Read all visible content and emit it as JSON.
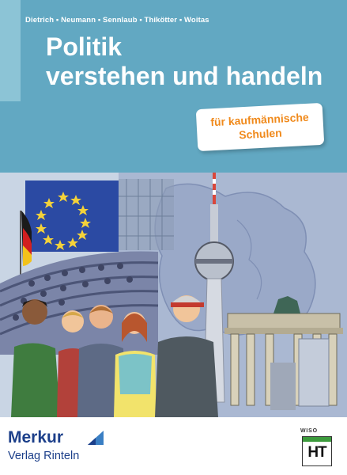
{
  "header": {
    "authors": "Dietrich ▪ Neumann ▪ Sennlaub ▪ Thikötter ▪ Woitas",
    "title_line1": "Politik",
    "title_line2": "verstehen und handeln"
  },
  "badge": {
    "line1": "für kaufmännische",
    "line2": "Schulen"
  },
  "publisher": {
    "name": "Merkur",
    "subline": "Verlag Rinteln"
  },
  "series_logo": {
    "label": "WISO",
    "mark": "HT"
  },
  "colors": {
    "header_bg": "#62a8c2",
    "badge_text": "#f08a1c",
    "publisher_blue": "#1c3f8a",
    "eu_blue": "#2b4aa3",
    "eu_star": "#f4d23a"
  },
  "icons": {
    "eu_flag": "eu-flag-icon",
    "german_flag": "german-flag-icon",
    "publisher_mark": "merkur-mark-icon"
  }
}
